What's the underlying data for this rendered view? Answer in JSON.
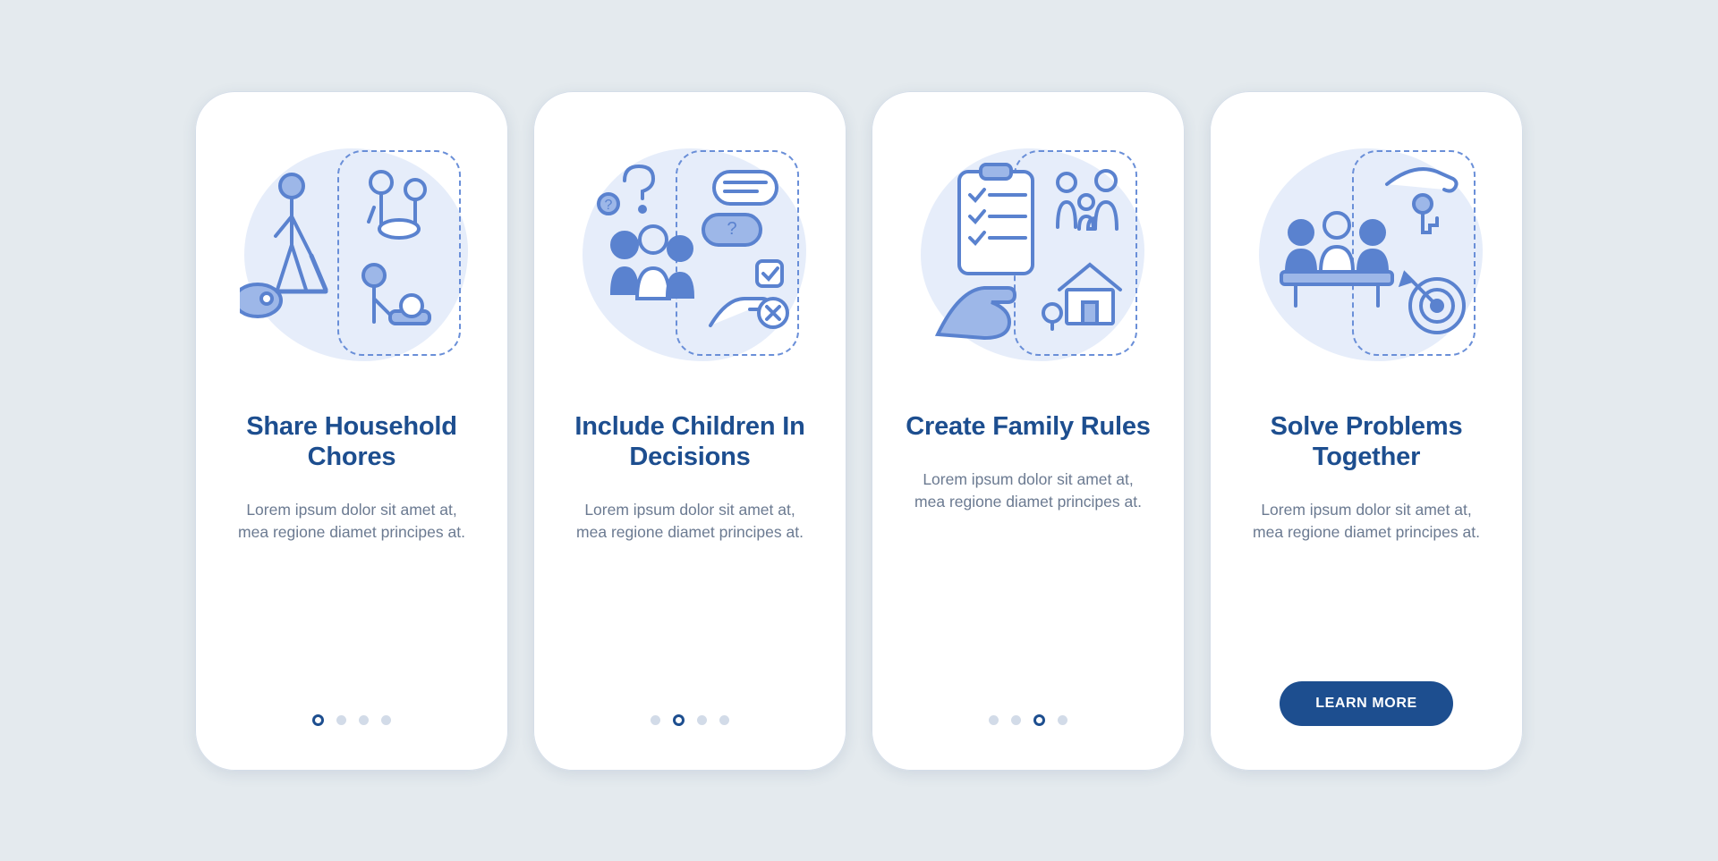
{
  "colors": {
    "accent": "#1d4e8f",
    "stroke": "#5a82cf",
    "fill": "#9db7e8",
    "blob": "#e6edfa"
  },
  "screens": [
    {
      "title": "Share Household Chores",
      "desc": "Lorem ipsum dolor sit amet at, mea regione diamet principes at.",
      "active_dot": 0,
      "icon": "household-chores-icon"
    },
    {
      "title": "Include Children In Decisions",
      "desc": "Lorem ipsum dolor sit amet at, mea regione diamet principes at.",
      "active_dot": 1,
      "icon": "children-decisions-icon"
    },
    {
      "title": "Create Family Rules",
      "desc": "Lorem ipsum dolor sit amet at, mea regione diamet principes at.",
      "active_dot": 2,
      "icon": "family-rules-icon"
    },
    {
      "title": "Solve Problems Together",
      "desc": "Lorem ipsum dolor sit amet at, mea regione diamet principes at.",
      "active_dot": 3,
      "icon": "solve-problems-icon",
      "cta": "LEARN MORE"
    }
  ],
  "dot_count": 4
}
